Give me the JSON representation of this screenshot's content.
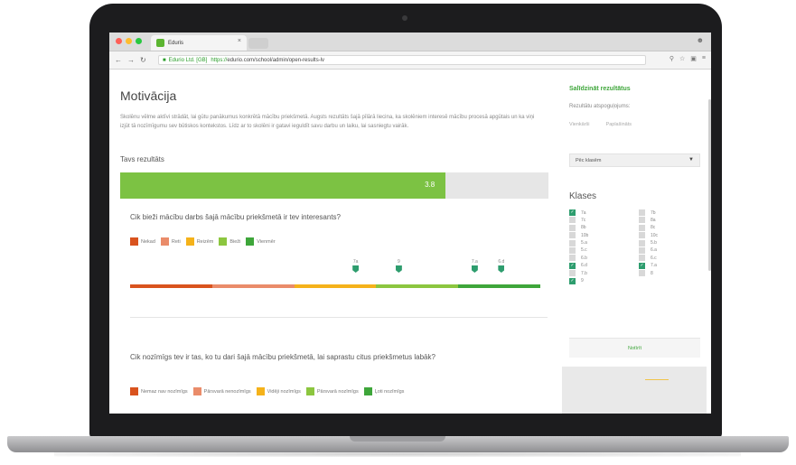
{
  "browser": {
    "tab_title": "Eduris",
    "tab_close": "×",
    "ev_label": "Edurio Ltd. [GB]",
    "url_https": "https://",
    "url_rest": "edurio.com/school/admin/open-results-lv"
  },
  "page": {
    "title": "Motivācija",
    "intro": "Skolēnu vēlme aktīvi strādāt, lai gūtu panākumus konkrētā mācību priekšmetā. Augsts rezultāts šajā pīlārā liecina, ka skolēniem interesē mācību procesā apgūtais un ka viņi izjūt tā nozīmīgumu sev būtiskos kontekstos. Līdz ar to skolēni ir gatavi ieguldīt savu darbu un laiku, lai sasniegtu vairāk.",
    "your_result_label": "Tavs rezultāts",
    "score": {
      "value": 3.8,
      "label": "3.8",
      "max": 5
    },
    "question1": "Cik bieži mācību darbs šajā mācību priekšmetā ir tev interesants?",
    "legend1": [
      {
        "label": "Nekad",
        "color": "#d9531e"
      },
      {
        "label": "Reti",
        "color": "#ea8c6a"
      },
      {
        "label": "Reizēm",
        "color": "#f5b21a"
      },
      {
        "label": "Bieži",
        "color": "#8cc63f"
      },
      {
        "label": "Vienmēr",
        "color": "#3ea63a"
      }
    ],
    "markers": [
      {
        "label": "7a",
        "position": 0.55
      },
      {
        "label": "9",
        "position": 0.655
      },
      {
        "label": "7.a",
        "position": 0.84
      },
      {
        "label": "6.d",
        "position": 0.905
      }
    ],
    "question2": "Cik nozīmīgs tev ir tas, ko tu dari šajā mācību priekšmetā, lai saprastu citus priekšmetus labāk?",
    "legend2": [
      {
        "label": "Nemaz nav nozīmīgs",
        "color": "#d9531e"
      },
      {
        "label": "Pārsvarā nenozīmīgs",
        "color": "#ea8c6a"
      },
      {
        "label": "Vidēji nozīmīgs",
        "color": "#f5b21a"
      },
      {
        "label": "Pārsvarā nozīmīgs",
        "color": "#8cc63f"
      },
      {
        "label": "Ļoti nozīmīgs",
        "color": "#3ea63a"
      }
    ]
  },
  "sidebar": {
    "title": "Salīdzināt rezultātus",
    "subtitle": "Rezultātu atspoguļojums:",
    "tabs": [
      "Vienkārši",
      "Paplašināts"
    ],
    "select_value": "Pēc klasēm",
    "classes_heading": "Klases",
    "classes_left": [
      {
        "label": "7a",
        "checked": true
      },
      {
        "label": "7c",
        "checked": false
      },
      {
        "label": "8b",
        "checked": false
      },
      {
        "label": "10b",
        "checked": false
      },
      {
        "label": "5.a",
        "checked": false
      },
      {
        "label": "5.c",
        "checked": false
      },
      {
        "label": "6.b",
        "checked": false
      },
      {
        "label": "6.d",
        "checked": true
      },
      {
        "label": "7.b",
        "checked": false
      },
      {
        "label": "9",
        "checked": true
      }
    ],
    "classes_right": [
      {
        "label": "7b",
        "checked": false
      },
      {
        "label": "8a",
        "checked": false
      },
      {
        "label": "8c",
        "checked": false
      },
      {
        "label": "10c",
        "checked": false
      },
      {
        "label": "5.b",
        "checked": false
      },
      {
        "label": "6.a",
        "checked": false
      },
      {
        "label": "6.c",
        "checked": false
      },
      {
        "label": "7.a",
        "checked": true
      },
      {
        "label": "8",
        "checked": false
      }
    ],
    "button_label": "Notīrīt"
  },
  "colors": {
    "accent_green": "#3ea63a",
    "score_fill": "#7cc243",
    "checkbox_on": "#2e9d6e",
    "traffic_red": "#ff5f57",
    "traffic_yellow": "#febc2e",
    "traffic_green": "#28c840"
  }
}
